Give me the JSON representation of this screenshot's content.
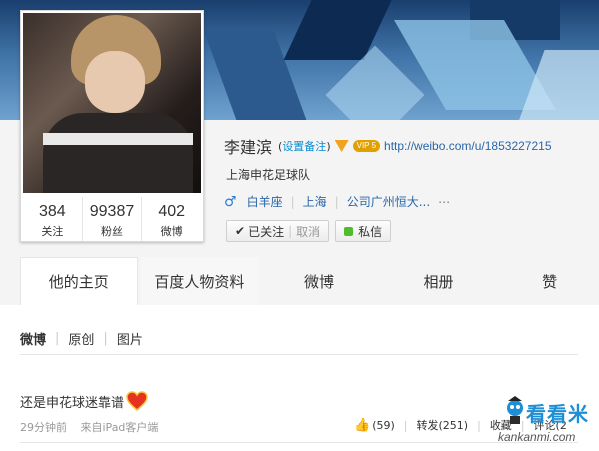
{
  "profile": {
    "name": "李建滨",
    "remark_prefix": "(",
    "remark_link": "设置备注",
    "remark_suffix": ")",
    "vip_badge": "VIP 5",
    "url": "http://weibo.com/u/1853227215",
    "bio": "上海申花足球队",
    "gender_icon": "male-icon",
    "zodiac": "白羊座",
    "location": "上海",
    "company": "公司广州恒大...",
    "more": "⋯"
  },
  "stats": [
    {
      "num": "384",
      "label": "关注"
    },
    {
      "num": "99387",
      "label": "粉丝"
    },
    {
      "num": "402",
      "label": "微博"
    }
  ],
  "buttons": {
    "followed": "已关注",
    "cancel": "取消",
    "message": "私信"
  },
  "tabs": [
    "他的主页",
    "百度人物资料",
    "微博",
    "相册",
    "赞"
  ],
  "subtabs": {
    "current": "微博",
    "original": "原创",
    "pictures": "图片"
  },
  "post": {
    "text": "还是申花球迷靠谱",
    "time": "29分钟前",
    "source": "来自iPad客户端",
    "likes": "(59)",
    "forward": "转发(251)",
    "collect": "收藏",
    "comment": "评论(2"
  },
  "watermark": {
    "title": "看看米",
    "site": "kankanmi.com"
  },
  "colors": {
    "link": "#2a66a8",
    "accent": "#0a8cd2",
    "green": "#4fbd2b",
    "watermark": "#1e8fd6"
  }
}
